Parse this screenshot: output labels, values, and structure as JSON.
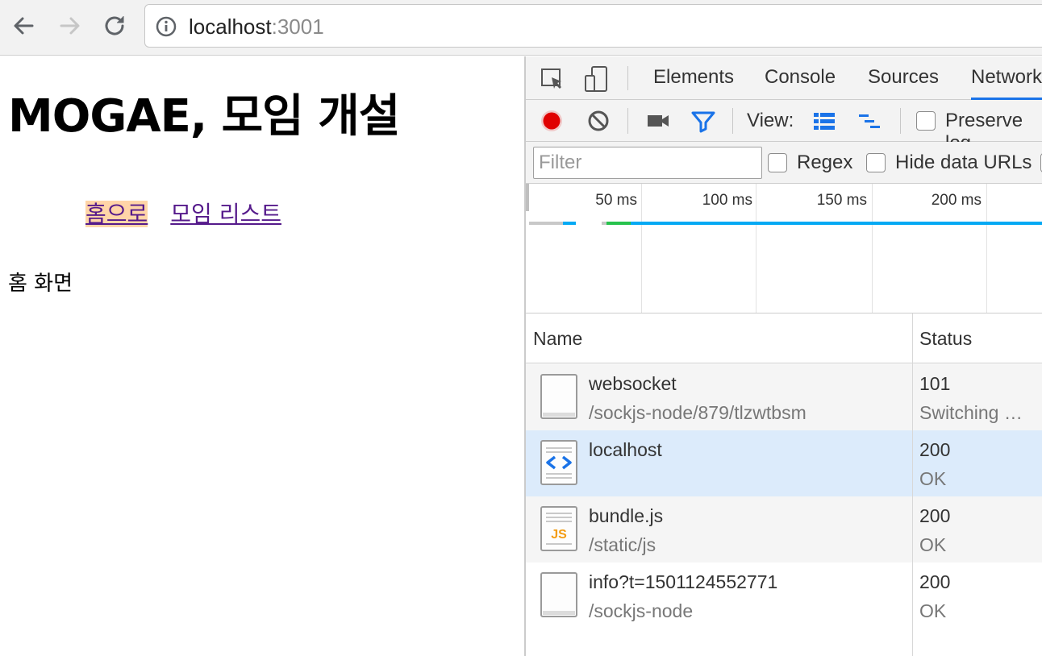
{
  "browser": {
    "url_host": "localhost",
    "url_port": ":3001"
  },
  "page": {
    "heading": "MOGAE, 모임 개설",
    "nav_links": [
      "홈으로",
      "모임 리스트"
    ],
    "body_text": "홈 화면"
  },
  "devtools": {
    "tabs": [
      "Elements",
      "Console",
      "Sources",
      "Network"
    ],
    "active_tab": "Network",
    "toolbar": {
      "view_label": "View:",
      "preserve_log_label": "Preserve log"
    },
    "filter": {
      "placeholder": "Filter",
      "regex_label": "Regex",
      "hide_data_urls_label": "Hide data URLs"
    },
    "timeline": {
      "ticks": [
        "50 ms",
        "100 ms",
        "150 ms",
        "200 ms"
      ]
    },
    "columns": {
      "name": "Name",
      "status": "Status"
    },
    "requests": [
      {
        "name": "websocket",
        "path": "/sockjs-node/879/tlzwtbsm",
        "status_code": "101",
        "status_text": "Switching …",
        "icon": "document-icon"
      },
      {
        "name": "localhost",
        "path": "",
        "status_code": "200",
        "status_text": "OK",
        "icon": "html-file-icon"
      },
      {
        "name": "bundle.js",
        "path": "/static/js",
        "status_code": "200",
        "status_text": "OK",
        "icon": "js-file-icon"
      },
      {
        "name": "info?t=1501124552771",
        "path": "/sockjs-node",
        "status_code": "200",
        "status_text": "OK",
        "icon": "document-icon"
      }
    ],
    "colors": {
      "record": "#e00000",
      "filter_active": "#1a73e8",
      "selected_row": "#dcebfb"
    }
  }
}
